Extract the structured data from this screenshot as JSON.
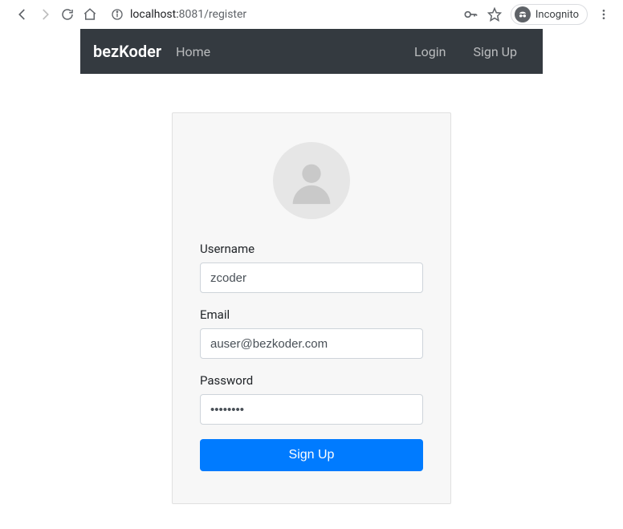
{
  "browser": {
    "url_host": "localhost:",
    "url_port": "8081",
    "url_path": "/register",
    "incognito_label": "Incognito"
  },
  "navbar": {
    "brand": "bezKoder",
    "items": [
      {
        "label": "Home"
      }
    ],
    "right_items": [
      {
        "label": "Login"
      },
      {
        "label": "Sign Up"
      }
    ]
  },
  "form": {
    "username_label": "Username",
    "username_value": "zcoder",
    "email_label": "Email",
    "email_value": "auser@bezkoder.com",
    "password_label": "Password",
    "password_value": "••••••••",
    "submit_label": "Sign Up"
  }
}
